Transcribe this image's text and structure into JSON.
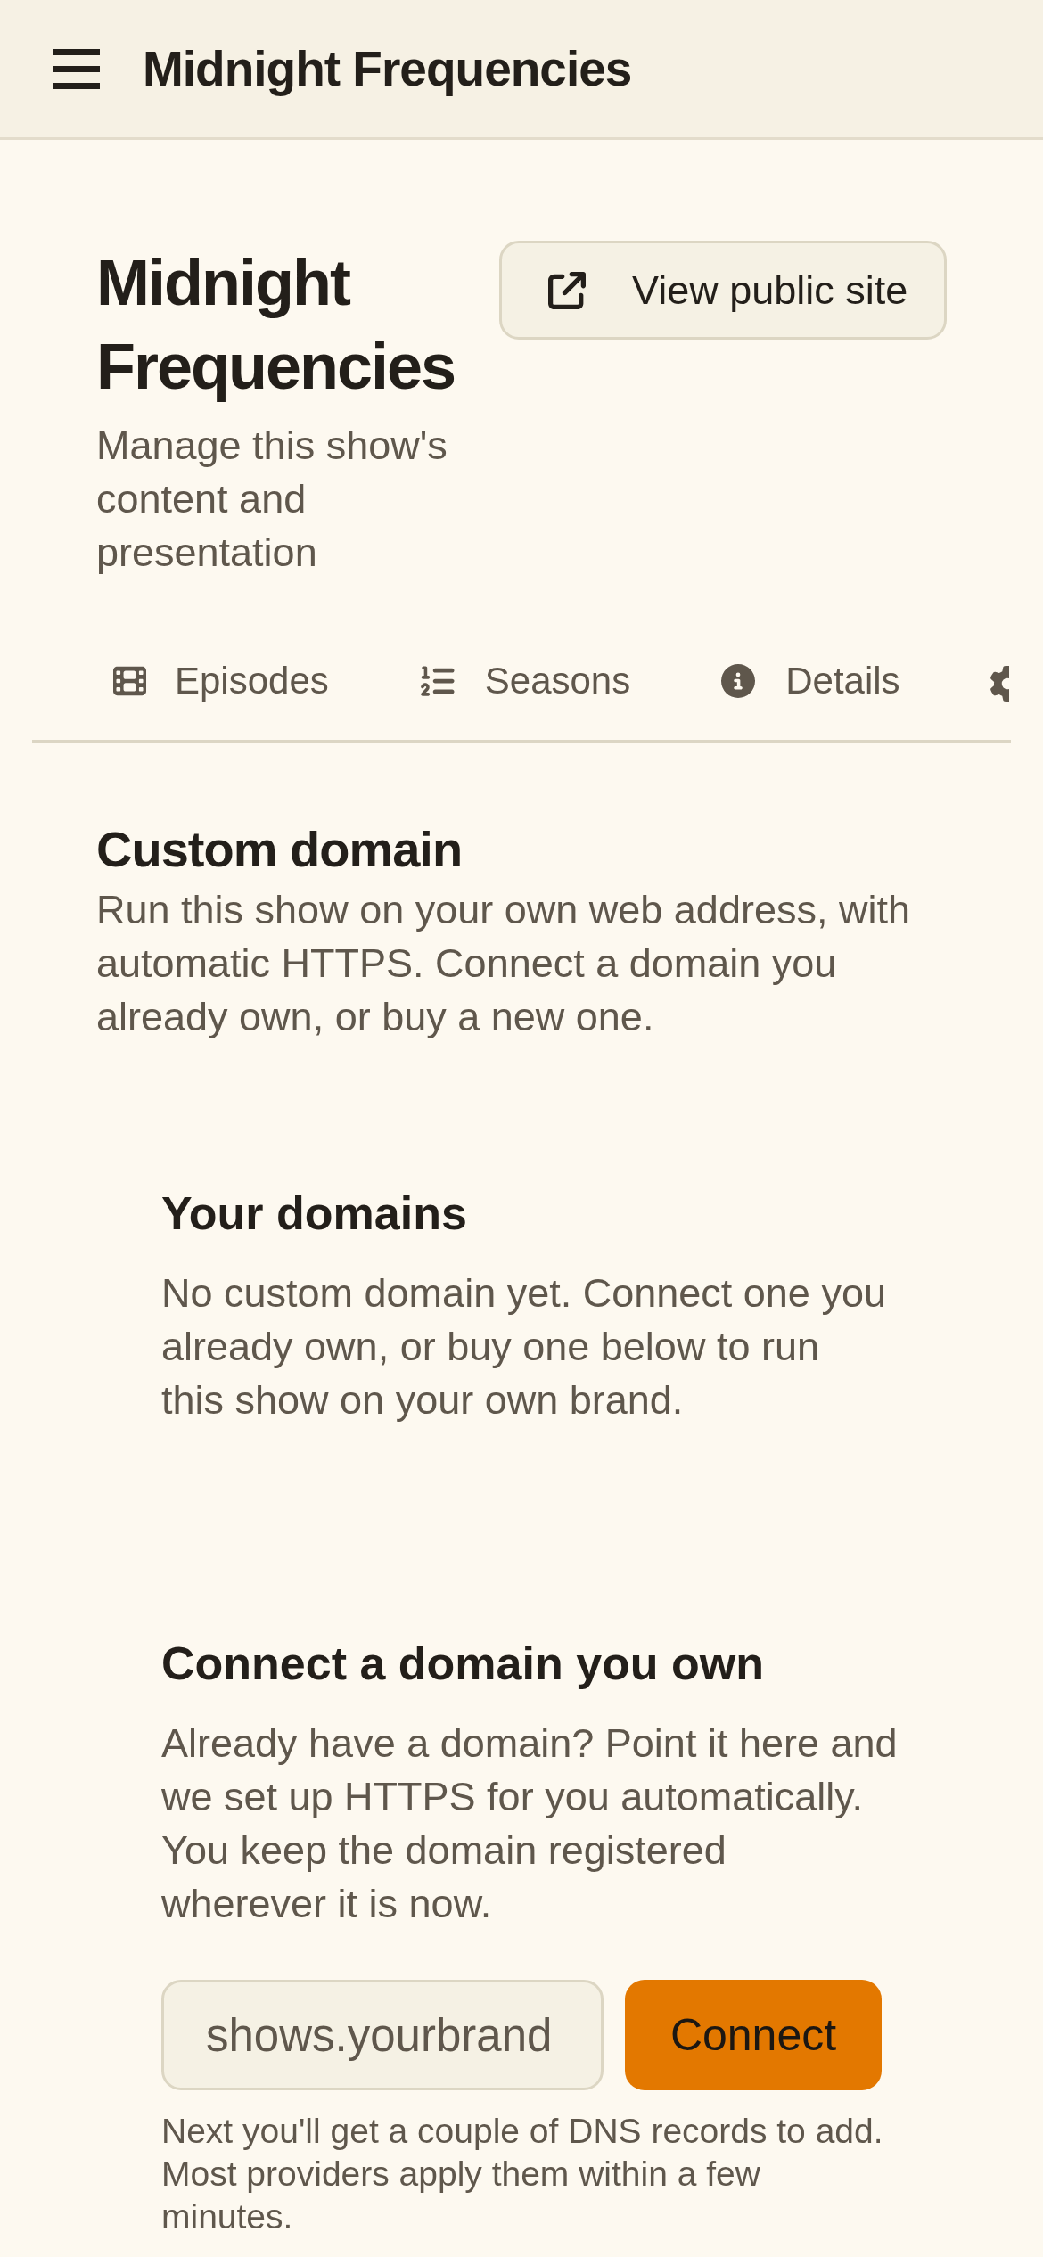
{
  "header": {
    "title": "Midnight Frequencies"
  },
  "show": {
    "title": "Midnight Frequencies",
    "subtitle": "Manage this show's content and presentation",
    "view_site_button": "View public site"
  },
  "tabs": [
    {
      "label": "Episodes",
      "selected": false
    },
    {
      "label": "Seasons",
      "selected": false
    },
    {
      "label": "Details",
      "selected": false
    }
  ],
  "custom_domain": {
    "title": "Custom domain",
    "description": "Run this show on your own web address, with automatic HTTPS. Connect a domain you already own, or buy a new one."
  },
  "your_domains": {
    "title": "Your domains",
    "empty_message": "No custom domain yet. Connect one you already own, or buy one below to run this show on your own brand."
  },
  "connect_domain": {
    "title": "Connect a domain you own",
    "description": "Already have a domain? Point it here and we set up HTTPS for you automatically. You keep the domain registered wherever it is now.",
    "domain_field": {
      "placeholder": "shows.yourbrand"
    },
    "connect_button": "Connect",
    "note": "Next you'll get a couple of DNS records to add. Most providers apply them within a few minutes."
  }
}
